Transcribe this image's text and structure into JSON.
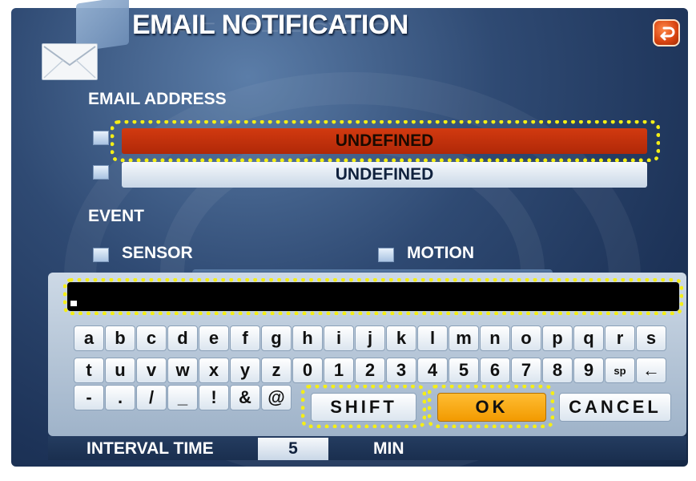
{
  "title": "EMAIL NOTIFICATION",
  "email_address": {
    "label": "EMAIL ADDRESS",
    "entries": [
      {
        "value": "UNDEFINED",
        "selected": true
      },
      {
        "value": "UNDEFINED",
        "selected": false
      }
    ]
  },
  "event": {
    "label": "EVENT",
    "options": [
      {
        "label": "SENSOR"
      },
      {
        "label": "MOTION"
      }
    ]
  },
  "keyboard": {
    "input_value": "",
    "row1": [
      "a",
      "b",
      "c",
      "d",
      "e",
      "f",
      "g",
      "h",
      "i",
      "j",
      "k",
      "l",
      "m",
      "n",
      "o",
      "p",
      "q",
      "r",
      "s"
    ],
    "row2": [
      "t",
      "u",
      "v",
      "w",
      "x",
      "y",
      "z",
      "0",
      "1",
      "2",
      "3",
      "4",
      "5",
      "6",
      "7",
      "8",
      "9",
      "sp",
      "←"
    ],
    "row3": [
      "-",
      ".",
      "/",
      "_",
      "!",
      "&",
      "@"
    ],
    "shift_label": "SHIFT",
    "ok_label": "OK",
    "cancel_label": "CANCEL"
  },
  "interval": {
    "label": "INTERVAL TIME",
    "value": "5",
    "unit": "MIN"
  },
  "icons": {
    "envelope": "envelope-icon",
    "back": "return-arrow-icon"
  },
  "colors": {
    "selected_field": "#c0320c",
    "highlight_dots": "#f4ee17",
    "ok_button": "#f5a300"
  }
}
